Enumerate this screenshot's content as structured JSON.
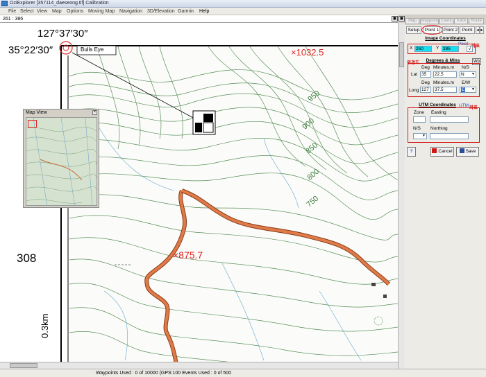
{
  "window": {
    "title": "OziExplorer [357114_daeseong.tif] Calibration"
  },
  "menu": [
    "File",
    "Select",
    "View",
    "Map",
    "Options",
    "Moving Map",
    "Navigation",
    "3D/Elevation",
    "Garmin",
    "Help"
  ],
  "coord_readout": "261 : 386",
  "right_tabs": [
    "Map",
    "Waypoint",
    "Event",
    "Track",
    "Route"
  ],
  "map": {
    "lat_label": "127°37′30″",
    "lon_label": "35°22′30″",
    "bulls_eye_label": "Bulls Eye",
    "elev_1032": "×1032.5",
    "elev_875": "×875.7",
    "contour_labels": [
      "950",
      "900",
      "850",
      "800",
      "750"
    ],
    "left_number": "308",
    "scale_label": "0.3km",
    "top_partial_left": "2\u0003",
    "top_partial_right": "\u0003\u0003\u0003"
  },
  "map_view": {
    "title": "Map View"
  },
  "panel": {
    "tabs": [
      "Setup",
      "Point 1",
      "Point 2",
      "Point"
    ],
    "image_coords": {
      "title": "Image Coordinates",
      "x_label": "X",
      "x_value": "260",
      "y_label": "Y",
      "y_value": "386",
      "checked": "√",
      "pixel_label": "Pixel",
      "pixel_kr": "좌표"
    },
    "degrees": {
      "kr_prefix": "위경도",
      "title": "Degrees & Mins",
      "wp_button": "Wp",
      "col_deg": "Deg",
      "col_min": "Minutes.m",
      "col_ns": "N/S",
      "col_ew": "E/W",
      "lat_label": "Lat",
      "lat_deg": "35",
      "lat_min": "22.5",
      "lat_ns": "N",
      "long_label": "Long",
      "long_deg": "127",
      "long_min": "37.5",
      "long_ew": "E"
    },
    "utm": {
      "title": "UTM Coordinates",
      "utm_label": "UTM",
      "utm_kr": "좌표",
      "zone_label": "Zone",
      "easting_label": "Easting",
      "ns_label": "N/S",
      "northing_label": "Northing"
    },
    "buttons": {
      "help": "?",
      "cancel": "Cancel",
      "save": "Save"
    }
  },
  "status": "Waypoints Used : 0 of 10000  (GPS:100 Events Used : 0 of 500"
}
